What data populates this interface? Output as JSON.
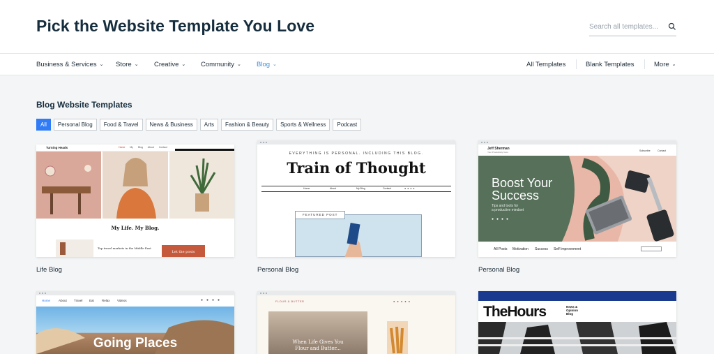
{
  "header": {
    "title": "Pick the Website Template You Love",
    "search_placeholder": "Search all templates..."
  },
  "nav": {
    "left": [
      {
        "label": "Business & Services",
        "chevron": true
      },
      {
        "label": "Store",
        "chevron": true
      },
      {
        "label": "Creative",
        "chevron": true
      },
      {
        "label": "Community",
        "chevron": true
      },
      {
        "label": "Blog",
        "chevron": true,
        "active": true
      }
    ],
    "right": [
      {
        "label": "All Templates"
      },
      {
        "label": "Blank Templates"
      },
      {
        "label": "More",
        "chevron": true
      }
    ]
  },
  "section": {
    "title": "Blog Website Templates",
    "filters": [
      "All",
      "Personal Blog",
      "Food & Travel",
      "News & Business",
      "Arts",
      "Fashion & Beauty",
      "Sports & Wellness",
      "Podcast"
    ],
    "active_filter": "All"
  },
  "cards": [
    {
      "label": "Life Blog",
      "brand": "Turning Heads",
      "menu": [
        "Home",
        "My Blog",
        "About",
        "Contact"
      ],
      "headline": "My Life. My Blog.",
      "post_title": "Top travel markets in the Middle East",
      "button": "Let the posts"
    },
    {
      "label": "Personal Blog",
      "tagline": "EVERYTHING IS PERSONAL. INCLUDING THIS BLOG.",
      "headline": "Train of Thought",
      "menu": [
        "Home",
        "About",
        "My Blog",
        "Contact"
      ],
      "featured": "FEATURED POST"
    },
    {
      "label": "Personal Blog",
      "name": "Jeff Sherman",
      "sub": "Your Productivity Guru",
      "top_links": [
        "Subscribe",
        "Contact"
      ],
      "headline_1": "Boost Your",
      "headline_2": "Success",
      "tips_1": "Tips and tools for",
      "tips_2": "a productive mindset",
      "bottom_links": [
        "All Posts",
        "Motivation",
        "Success",
        "Self Improvement"
      ]
    },
    {
      "menu": [
        "Home",
        "About",
        "Travel",
        "Eat",
        "Relax",
        "Videos"
      ],
      "headline": "Going Places"
    },
    {
      "brand": "FLOUR & BUTTER",
      "headline_1": "When Life Gives You",
      "headline_2": "Flour and Butter..."
    },
    {
      "headline": "TheHours",
      "sub_1": "News &",
      "sub_2": "Opinion",
      "sub_3": "Blog"
    }
  ],
  "colors": {
    "accent": "#2f7cf6",
    "nav_active": "#3f8ed8",
    "background": "#f4f5f6"
  }
}
